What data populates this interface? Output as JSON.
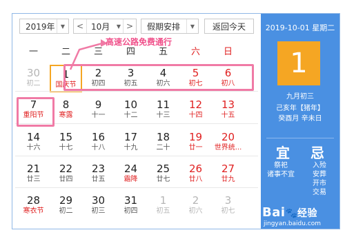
{
  "top_strip": "",
  "toolbar": {
    "year": "2019年",
    "month_prev": "<",
    "month": "10月",
    "month_next": ">",
    "holiday": "假期安排",
    "today_btn": "返回今天"
  },
  "annotation": "高速公路免费通行",
  "weekdays": [
    "一",
    "二",
    "三",
    "四",
    "五",
    "六",
    "日"
  ],
  "days": [
    {
      "num": "30",
      "sub": "初二"
    },
    {
      "num": "1",
      "sub": "国庆节"
    },
    {
      "num": "2",
      "sub": "初四"
    },
    {
      "num": "3",
      "sub": "初五"
    },
    {
      "num": "4",
      "sub": "初六"
    },
    {
      "num": "5",
      "sub": "初七"
    },
    {
      "num": "6",
      "sub": "初八"
    },
    {
      "num": "7",
      "sub": "重阳节"
    },
    {
      "num": "8",
      "sub": "寒露"
    },
    {
      "num": "9",
      "sub": "十一"
    },
    {
      "num": "10",
      "sub": "十二"
    },
    {
      "num": "11",
      "sub": "十三"
    },
    {
      "num": "12",
      "sub": "十四"
    },
    {
      "num": "13",
      "sub": "十五"
    },
    {
      "num": "14",
      "sub": "十六"
    },
    {
      "num": "15",
      "sub": "十七"
    },
    {
      "num": "16",
      "sub": "十八"
    },
    {
      "num": "17",
      "sub": "十九"
    },
    {
      "num": "18",
      "sub": "二十"
    },
    {
      "num": "19",
      "sub": "廿一"
    },
    {
      "num": "20",
      "sub": "世界统..."
    },
    {
      "num": "21",
      "sub": "廿三"
    },
    {
      "num": "22",
      "sub": "廿四"
    },
    {
      "num": "23",
      "sub": "廿五"
    },
    {
      "num": "24",
      "sub": "霜降"
    },
    {
      "num": "25",
      "sub": "廿七"
    },
    {
      "num": "26",
      "sub": "廿八"
    },
    {
      "num": "27",
      "sub": "廿九"
    },
    {
      "num": "28",
      "sub": "寒衣节"
    },
    {
      "num": "29",
      "sub": "初二"
    },
    {
      "num": "30",
      "sub": "初三"
    },
    {
      "num": "31",
      "sub": "初四"
    },
    {
      "num": "1",
      "sub": "初五"
    },
    {
      "num": "2",
      "sub": "初六"
    },
    {
      "num": "3",
      "sub": "初七"
    }
  ],
  "side": {
    "date": "2019-10-01 星期二",
    "big_day": "1",
    "lunar": "九月初三",
    "year_gz": "己亥年【猪年】",
    "month_day_gz": "癸酉月 辛未日",
    "yi_title": "宜",
    "ji_title": "忌",
    "yi_items": [
      "祭祀",
      "诸事不宜"
    ],
    "ji_items": [
      "入殓",
      "安葬",
      "开市",
      "交易"
    ]
  },
  "watermark": {
    "brand": "Bai",
    "brand2": "经验",
    "site": "jingyan.baidu.com"
  },
  "colors": {
    "accent": "#4a90e2",
    "selected": "#f5a623",
    "highlight": "#f07aa5",
    "weekend": "#e02020"
  }
}
